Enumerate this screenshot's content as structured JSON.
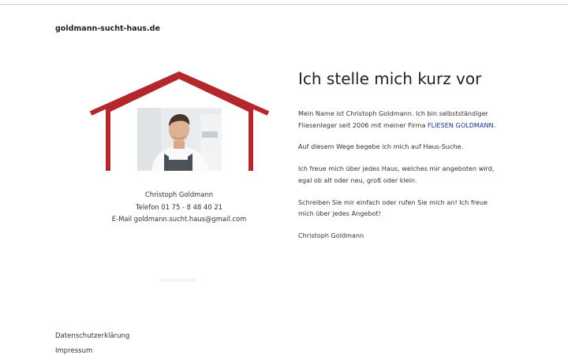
{
  "site": {
    "title": "goldmann-sucht-haus.de"
  },
  "profile": {
    "name": "Christoph Goldmann",
    "phone": "Telefon 01 75 - 8 48 40 21",
    "email": "E-Mail  goldmann.sucht.haus@gmail.com"
  },
  "main": {
    "heading": "Ich stelle mich kurz vor",
    "p1_text": "Mein Name ist Christoph Goldmann. Ich bin selbstständiger Fliesenleger seit 2006 mit meiner Firma ",
    "p1_link": "FLIESEN GOLDMANN",
    "p1_end": ".",
    "p2": "Auf diesem Wege begebe ich mich auf Haus-Suche.",
    "p3": "Ich freue mich über jedes Haus, welches mir angeboten wird, egal ob alt oder neu, groß oder klein.",
    "p4": "Schreiben Sie mir einfach oder rufen Sie mich an! Ich freue mich über jedes Angebot!",
    "signature": "Christoph Goldmann"
  },
  "footer": {
    "privacy": "Datenschutzerklärung",
    "imprint": "Impressum"
  },
  "colors": {
    "house_red": "#b3272d",
    "link": "#1f2c8c"
  }
}
